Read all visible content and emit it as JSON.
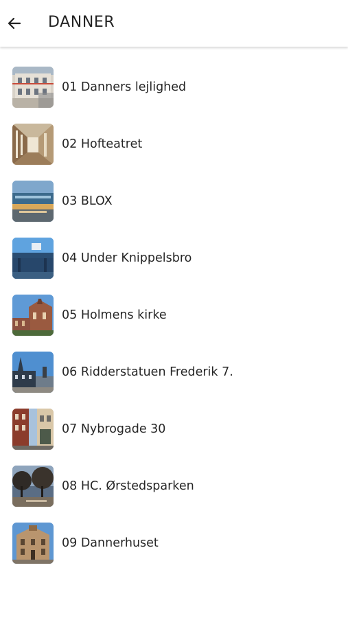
{
  "header": {
    "title": "DANNER",
    "back_icon": "arrow-left-icon"
  },
  "colors": {
    "text": "#222222",
    "divider_shadow": "#d9d9d9",
    "background": "#ffffff"
  },
  "items": [
    {
      "label": "01 Danners lejlighed",
      "thumb": "building-facade-photo"
    },
    {
      "label": "02 Hofteatret",
      "thumb": "theatre-corridor-photo"
    },
    {
      "label": "03 BLOX",
      "thumb": "modern-building-photo"
    },
    {
      "label": "04 Under Knippelsbro",
      "thumb": "bridge-photo"
    },
    {
      "label": "05 Holmens kirke",
      "thumb": "church-photo"
    },
    {
      "label": "06 Ridderstatuen Frederik 7.",
      "thumb": "statue-square-photo"
    },
    {
      "label": "07 Nybrogade 30",
      "thumb": "street-photo"
    },
    {
      "label": "08 HC. Ørstedsparken",
      "thumb": "park-photo"
    },
    {
      "label": "09 Dannerhuset",
      "thumb": "historic-house-photo"
    }
  ]
}
